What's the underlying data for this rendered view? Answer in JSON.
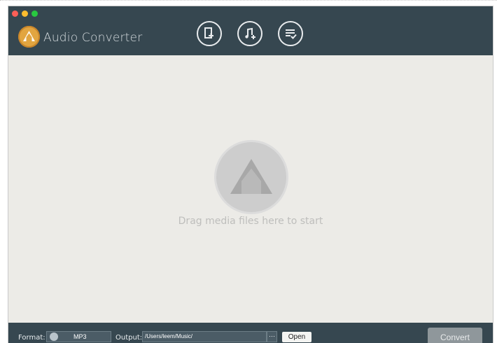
{
  "window": {
    "app_title": "Audio Converter",
    "traffic_colors": [
      "#fe5f57",
      "#febc2e",
      "#28c840"
    ]
  },
  "toolbar": {
    "buttons": [
      {
        "name": "add-files-button",
        "icon": "file-plus-icon"
      },
      {
        "name": "add-music-button",
        "icon": "music-plus-icon"
      },
      {
        "name": "conversion-list-button",
        "icon": "list-check-icon"
      }
    ]
  },
  "drop_area": {
    "hint": "Drag media files here to start"
  },
  "bottom": {
    "format_label": "Format:",
    "format_value": "MP3",
    "output_label": "Output:",
    "output_value": "/Users/leem/Music/",
    "browse_label": "···",
    "open_label": "Open",
    "convert_label": "Convert"
  },
  "colors": {
    "header_bg": "#364750",
    "logo_accent": "#e2a540",
    "content_bg": "#ecebe7"
  }
}
